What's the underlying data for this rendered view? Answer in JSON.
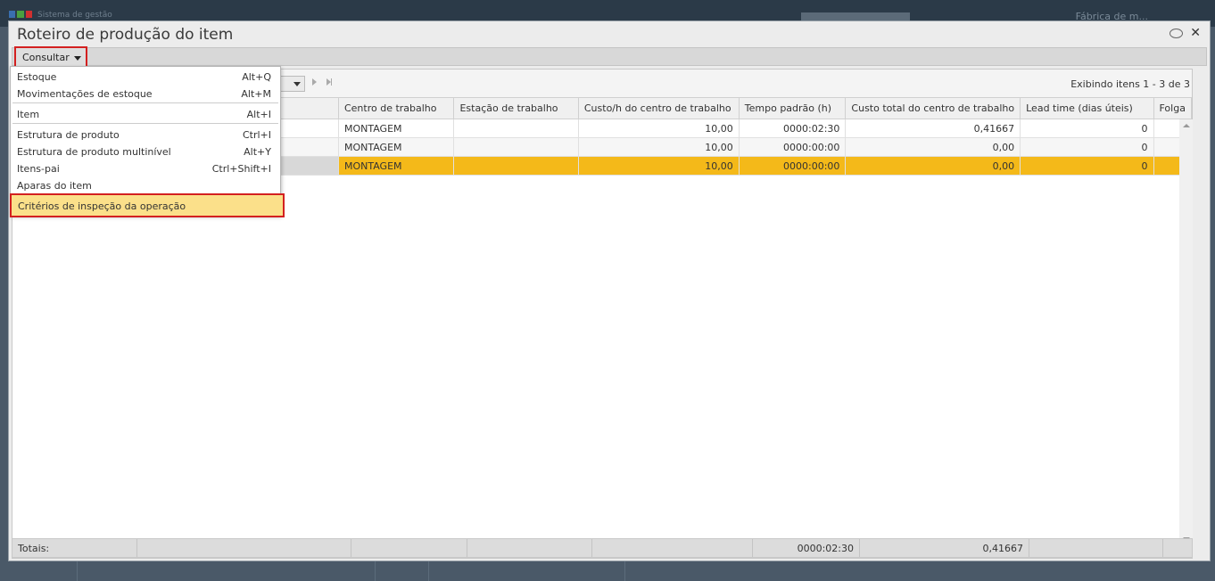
{
  "app": {
    "system_label": "Sistema de gestão",
    "company_label": "Fábrica de m...",
    "logo_colors": [
      "#3a6fb0",
      "#4aa040",
      "#d03030"
    ]
  },
  "dialog": {
    "title": "Roteiro de produção do item",
    "chat_icon": "speech-bubble-icon",
    "close_icon": "close-icon"
  },
  "toolbar": {
    "consultar_label": "Consultar"
  },
  "menu": {
    "items": [
      {
        "label": "Estoque",
        "shortcut": "Alt+Q"
      },
      {
        "label": "Movimentações de estoque",
        "shortcut": "Alt+M"
      },
      {
        "label": "Item",
        "shortcut": "Alt+I"
      },
      {
        "label": "Estrutura de produto",
        "shortcut": "Ctrl+I"
      },
      {
        "label": "Estrutura de produto multinível",
        "shortcut": "Alt+Y"
      },
      {
        "label": "Itens-pai",
        "shortcut": "Ctrl+Shift+I"
      },
      {
        "label": "Aparas do item",
        "shortcut": ""
      },
      {
        "label": "Critérios de inspeção da operação",
        "shortcut": ""
      }
    ],
    "highlight_color": "#fbe08a"
  },
  "pager": {
    "info": "Exibindo itens 1 - 3 de 3"
  },
  "grid": {
    "columns": [
      "Centro de trabalho",
      "Estação de trabalho",
      "Custo/h do centro de trabalho",
      "Tempo padrão (h)",
      "Custo total do centro de trabalho",
      "Lead time (dias úteis)",
      "Folga"
    ],
    "rows": [
      {
        "centro": "MONTAGEM",
        "estacao": "",
        "custo_h": "10,00",
        "tempo": "0000:02:30",
        "custo_total": "0,41667",
        "lead_time": "0",
        "folga": ""
      },
      {
        "centro": "MONTAGEM",
        "estacao": "",
        "custo_h": "10,00",
        "tempo": "0000:00:00",
        "custo_total": "0,00",
        "lead_time": "0",
        "folga": ""
      },
      {
        "centro": "MONTAGEM",
        "estacao": "",
        "custo_h": "10,00",
        "tempo": "0000:00:00",
        "custo_total": "0,00",
        "lead_time": "0",
        "folga": ""
      }
    ],
    "selected_row": 3,
    "selected_color": "#f4b919"
  },
  "totals": {
    "label": "Totais:",
    "tempo": "0000:02:30",
    "custo_total": "0,41667"
  }
}
